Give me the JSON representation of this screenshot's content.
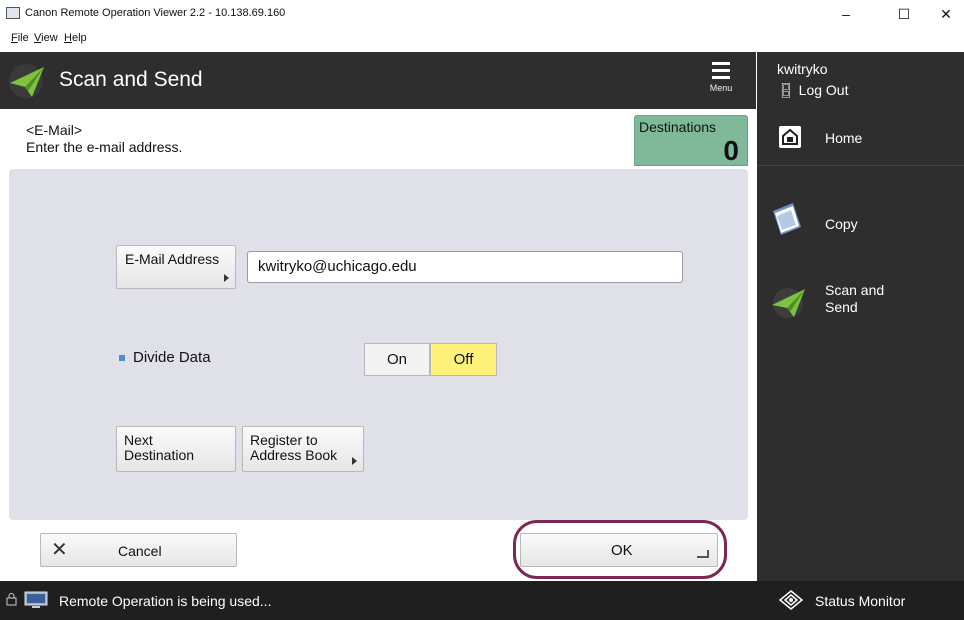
{
  "window": {
    "title": "Canon Remote Operation Viewer 2.2 - 10.138.69.160",
    "minimize": "–",
    "maximize": "☐",
    "close": "✕"
  },
  "menu": [
    {
      "prefix": "",
      "key": "F",
      "rest": "ile"
    },
    {
      "prefix": "",
      "key": "V",
      "rest": "iew"
    },
    {
      "prefix": "",
      "key": "H",
      "rest": "elp"
    }
  ],
  "header": {
    "title": "Scan and Send",
    "menu_label": "Menu",
    "user": "kwitryko",
    "logout": "Log Out"
  },
  "main": {
    "subtitle_line1": "<E-Mail>",
    "subtitle_line2": "Enter the e-mail address.",
    "destinations_label": "Destinations",
    "destinations_count": "0",
    "email_button": "E-Mail Address",
    "email_value": "kwitryko@uchicago.edu",
    "divide_label": "Divide Data",
    "divide_on": "On",
    "divide_off": "Off",
    "next_line1": "Next",
    "next_line2": "Destination",
    "register_line1": "Register to",
    "register_line2": "Address Book",
    "cancel": "Cancel",
    "ok": "OK"
  },
  "sidebar": {
    "items": [
      {
        "label": "Home",
        "icon": "home-icon"
      },
      {
        "label": "Copy",
        "icon": "copy-icon"
      },
      {
        "label1": "Scan and",
        "label2": "Send",
        "icon": "scan-send-icon"
      }
    ]
  },
  "status": {
    "text": "Remote Operation is being used...",
    "monitor": "Status Monitor"
  },
  "colors": {
    "header_bg": "#2e2e2e",
    "destinations_bg": "#7fb99a",
    "off_selected": "#fff27a",
    "ok_ring": "#7a2a52",
    "panel_bg": "#dfe0e8"
  }
}
